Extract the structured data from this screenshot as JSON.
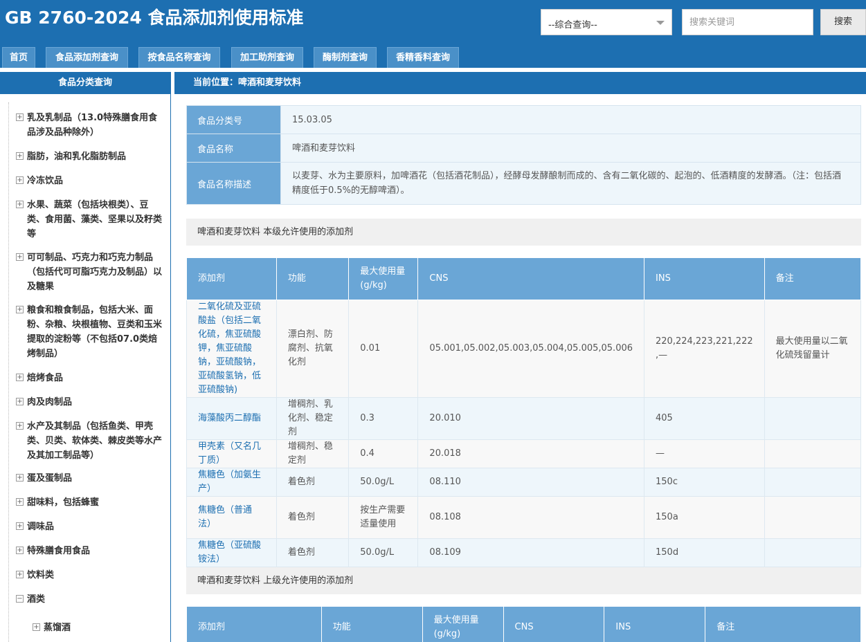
{
  "header": {
    "title": "GB 2760-2024 食品添加剂使用标准",
    "search_select": "--综合查询--",
    "search_placeholder": "搜索关键词",
    "search_button": "搜索"
  },
  "nav": {
    "tabs": [
      "首页",
      "食品添加剂查询",
      "按食品名称查询",
      "加工助剂查询",
      "酶制剂查询",
      "香精香料查询"
    ]
  },
  "sidebar": {
    "title": "食品分类查询",
    "items": [
      "乳及乳制品（13.0特殊膳食用食品涉及品种除外）",
      "脂肪，油和乳化脂肪制品",
      "冷冻饮品",
      "水果、蔬菜（包括块根类）、豆类、食用菌、藻类、坚果以及籽类等",
      "可可制品、巧克力和巧克力制品（包括代可可脂巧克力及制品）以及糖果",
      "粮食和粮食制品，包括大米、面粉、杂粮、块根植物、豆类和玉米提取的淀粉等（不包括07.0类焙烤制品）",
      "焙烤食品",
      "肉及肉制品",
      "水产及其制品（包括鱼类、甲壳类、贝类、软体类、棘皮类等水产及其加工制品等）",
      "蛋及蛋制品",
      "甜味料，包括蜂蜜",
      "调味品",
      "特殊膳食用食品",
      "饮料类",
      "酒类",
      "蒸馏酒"
    ]
  },
  "main": {
    "breadcrumb": "当前位置：啤酒和麦芽饮料",
    "info": {
      "code_label": "食品分类号",
      "code_value": "15.03.05",
      "name_label": "食品名称",
      "name_value": "啤酒和麦芽饮料",
      "desc_label": "食品名称描述",
      "desc_value": "以麦芽、水为主要原料，加啤酒花（包括酒花制品），经酵母发酵酿制而成的、含有二氧化碳的、起泡的、低酒精度的发酵酒。（注：包括酒精度低于0.5%的无醇啤酒）。"
    },
    "section1_title": "啤酒和麦芽饮料 本级允许使用的添加剂",
    "section2_title": "啤酒和麦芽饮料 上级允许使用的添加剂",
    "table_headers": [
      "添加剂",
      "功能",
      "最大使用量(g/kg)",
      "CNS",
      "INS",
      "备注"
    ],
    "rows": [
      {
        "name": "二氧化硫及亚硫酸盐（包括二氧化硫，焦亚硫酸钾，焦亚硫酸钠，亚硫酸钠，亚硫酸氢钠，低亚硫酸钠)",
        "func": "漂白剂、防腐剂、抗氧化剂",
        "max": "0.01",
        "cns": "05.001,05.002,05.003,05.004,05.005,05.006",
        "ins": "220,224,223,221,222 ,—",
        "note": "最大使用量以二氧化硫残留量计"
      },
      {
        "name": "海藻酸丙二醇酯",
        "func": "增稠剂、乳化剂、稳定剂",
        "max": "0.3",
        "cns": "20.010",
        "ins": "405",
        "note": ""
      },
      {
        "name": "甲壳素（又名几丁质）",
        "func": "增稠剂、稳定剂",
        "max": "0.4",
        "cns": "20.018",
        "ins": "—",
        "note": ""
      },
      {
        "name": "焦糖色（加氨生产）",
        "func": "着色剂",
        "max": "50.0g/L",
        "cns": "08.110",
        "ins": "150c",
        "note": ""
      },
      {
        "name": "焦糖色（普通法）",
        "func": "着色剂",
        "max": "按生产需要适量使用",
        "cns": "08.108",
        "ins": "150a",
        "note": ""
      },
      {
        "name": "焦糖色（亚硫酸铵法）",
        "func": "着色剂",
        "max": "50.0g/L",
        "cns": "08.109",
        "ins": "150d",
        "note": ""
      }
    ]
  }
}
